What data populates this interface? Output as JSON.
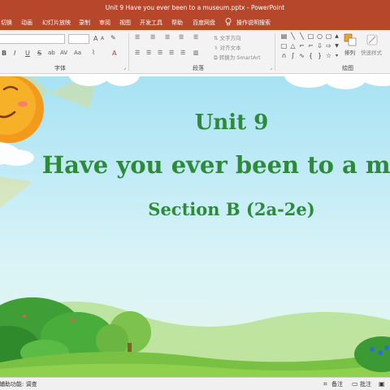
{
  "window": {
    "title": "Unit 9 Have you ever been to a museum.pptx  -  PowerPoint"
  },
  "menu": {
    "tabs": [
      "切换",
      "动画",
      "幻灯片放映",
      "录制",
      "审阅",
      "视图",
      "开发工具",
      "帮助",
      "百度网盘"
    ],
    "tell_me": "操作说明搜索"
  },
  "ribbon": {
    "groups": {
      "font": "字体",
      "paragraph": "段落",
      "drawing": "绘图"
    },
    "font_buttons": [
      "B",
      "I",
      "U",
      "S",
      "ab",
      "AV",
      "Aa"
    ],
    "text_direction": "文字方向",
    "align_text": "对齐文本",
    "convert_smartart": "转换为 SmartArt",
    "arrange": "排列",
    "quick_styles": "快速样式"
  },
  "slide": {
    "line1": "Unit 9",
    "line2": "Have you ever been to a museum",
    "line3": "Section B (2a-2e)"
  },
  "status": {
    "accessibility": "辅助功能: 调查",
    "notes": "备注",
    "comments": "批注"
  },
  "colors": {
    "accent": "#b7472a",
    "title_green": "#2e8a3b"
  }
}
